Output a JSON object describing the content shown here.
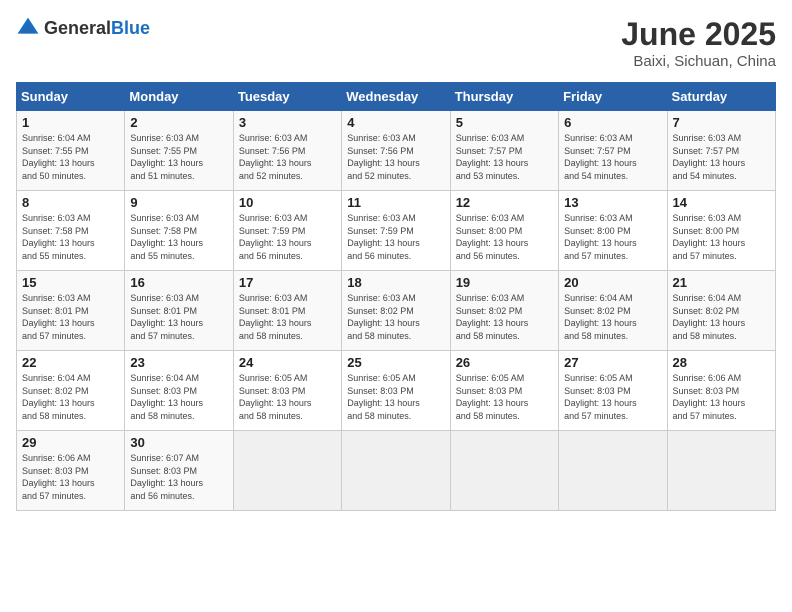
{
  "header": {
    "logo_general": "General",
    "logo_blue": "Blue",
    "title": "June 2025",
    "subtitle": "Baixi, Sichuan, China"
  },
  "days_of_week": [
    "Sunday",
    "Monday",
    "Tuesday",
    "Wednesday",
    "Thursday",
    "Friday",
    "Saturday"
  ],
  "weeks": [
    [
      {
        "day": "1",
        "detail": "Sunrise: 6:04 AM\nSunset: 7:55 PM\nDaylight: 13 hours\nand 50 minutes."
      },
      {
        "day": "2",
        "detail": "Sunrise: 6:03 AM\nSunset: 7:55 PM\nDaylight: 13 hours\nand 51 minutes."
      },
      {
        "day": "3",
        "detail": "Sunrise: 6:03 AM\nSunset: 7:56 PM\nDaylight: 13 hours\nand 52 minutes."
      },
      {
        "day": "4",
        "detail": "Sunrise: 6:03 AM\nSunset: 7:56 PM\nDaylight: 13 hours\nand 52 minutes."
      },
      {
        "day": "5",
        "detail": "Sunrise: 6:03 AM\nSunset: 7:57 PM\nDaylight: 13 hours\nand 53 minutes."
      },
      {
        "day": "6",
        "detail": "Sunrise: 6:03 AM\nSunset: 7:57 PM\nDaylight: 13 hours\nand 54 minutes."
      },
      {
        "day": "7",
        "detail": "Sunrise: 6:03 AM\nSunset: 7:57 PM\nDaylight: 13 hours\nand 54 minutes."
      }
    ],
    [
      {
        "day": "8",
        "detail": "Sunrise: 6:03 AM\nSunset: 7:58 PM\nDaylight: 13 hours\nand 55 minutes."
      },
      {
        "day": "9",
        "detail": "Sunrise: 6:03 AM\nSunset: 7:58 PM\nDaylight: 13 hours\nand 55 minutes."
      },
      {
        "day": "10",
        "detail": "Sunrise: 6:03 AM\nSunset: 7:59 PM\nDaylight: 13 hours\nand 56 minutes."
      },
      {
        "day": "11",
        "detail": "Sunrise: 6:03 AM\nSunset: 7:59 PM\nDaylight: 13 hours\nand 56 minutes."
      },
      {
        "day": "12",
        "detail": "Sunrise: 6:03 AM\nSunset: 8:00 PM\nDaylight: 13 hours\nand 56 minutes."
      },
      {
        "day": "13",
        "detail": "Sunrise: 6:03 AM\nSunset: 8:00 PM\nDaylight: 13 hours\nand 57 minutes."
      },
      {
        "day": "14",
        "detail": "Sunrise: 6:03 AM\nSunset: 8:00 PM\nDaylight: 13 hours\nand 57 minutes."
      }
    ],
    [
      {
        "day": "15",
        "detail": "Sunrise: 6:03 AM\nSunset: 8:01 PM\nDaylight: 13 hours\nand 57 minutes."
      },
      {
        "day": "16",
        "detail": "Sunrise: 6:03 AM\nSunset: 8:01 PM\nDaylight: 13 hours\nand 57 minutes."
      },
      {
        "day": "17",
        "detail": "Sunrise: 6:03 AM\nSunset: 8:01 PM\nDaylight: 13 hours\nand 58 minutes."
      },
      {
        "day": "18",
        "detail": "Sunrise: 6:03 AM\nSunset: 8:02 PM\nDaylight: 13 hours\nand 58 minutes."
      },
      {
        "day": "19",
        "detail": "Sunrise: 6:03 AM\nSunset: 8:02 PM\nDaylight: 13 hours\nand 58 minutes."
      },
      {
        "day": "20",
        "detail": "Sunrise: 6:04 AM\nSunset: 8:02 PM\nDaylight: 13 hours\nand 58 minutes."
      },
      {
        "day": "21",
        "detail": "Sunrise: 6:04 AM\nSunset: 8:02 PM\nDaylight: 13 hours\nand 58 minutes."
      }
    ],
    [
      {
        "day": "22",
        "detail": "Sunrise: 6:04 AM\nSunset: 8:02 PM\nDaylight: 13 hours\nand 58 minutes."
      },
      {
        "day": "23",
        "detail": "Sunrise: 6:04 AM\nSunset: 8:03 PM\nDaylight: 13 hours\nand 58 minutes."
      },
      {
        "day": "24",
        "detail": "Sunrise: 6:05 AM\nSunset: 8:03 PM\nDaylight: 13 hours\nand 58 minutes."
      },
      {
        "day": "25",
        "detail": "Sunrise: 6:05 AM\nSunset: 8:03 PM\nDaylight: 13 hours\nand 58 minutes."
      },
      {
        "day": "26",
        "detail": "Sunrise: 6:05 AM\nSunset: 8:03 PM\nDaylight: 13 hours\nand 58 minutes."
      },
      {
        "day": "27",
        "detail": "Sunrise: 6:05 AM\nSunset: 8:03 PM\nDaylight: 13 hours\nand 57 minutes."
      },
      {
        "day": "28",
        "detail": "Sunrise: 6:06 AM\nSunset: 8:03 PM\nDaylight: 13 hours\nand 57 minutes."
      }
    ],
    [
      {
        "day": "29",
        "detail": "Sunrise: 6:06 AM\nSunset: 8:03 PM\nDaylight: 13 hours\nand 57 minutes."
      },
      {
        "day": "30",
        "detail": "Sunrise: 6:07 AM\nSunset: 8:03 PM\nDaylight: 13 hours\nand 56 minutes."
      },
      {
        "day": "",
        "detail": ""
      },
      {
        "day": "",
        "detail": ""
      },
      {
        "day": "",
        "detail": ""
      },
      {
        "day": "",
        "detail": ""
      },
      {
        "day": "",
        "detail": ""
      }
    ]
  ]
}
